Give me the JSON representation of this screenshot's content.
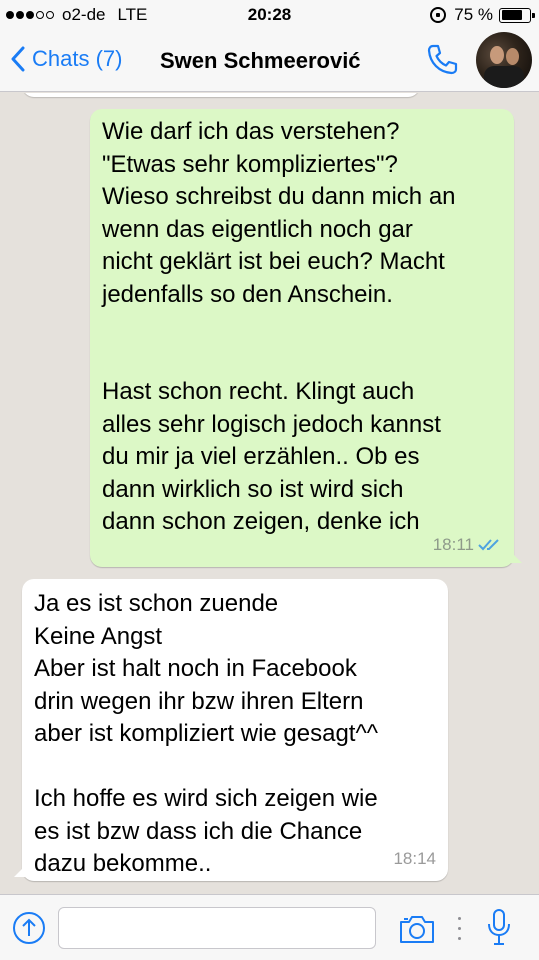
{
  "status_bar": {
    "carrier": "o2-de",
    "network": "LTE",
    "time": "20:28",
    "battery": "75 %",
    "battery_level": 0.75,
    "signal_bars": 3
  },
  "header": {
    "back_label": "Chats (7)",
    "contact_name": "Swen Schmeerović",
    "accent_color": "#1a7cf5"
  },
  "messages": {
    "outgoing": {
      "lines": [
        "Wie darf ich das verstehen?",
        "\"Etwas sehr kompliziertes\"?",
        "Wieso schreibst du dann mich an",
        "wenn das eigentlich noch gar",
        "nicht geklärt ist bei euch? Macht",
        "jedenfalls so den Anschein.",
        "Hast schon recht. Klingt auch",
        "alles sehr logisch jedoch kannst",
        "du mir ja viel erzählen.. Ob es",
        "dann wirklich so ist wird sich",
        "dann schon zeigen, denke ich"
      ],
      "time": "18:11",
      "status": "read",
      "bubble_color": "#dcf8c6"
    },
    "incoming": {
      "lines": [
        "Ja es ist schon zuende",
        "Keine Angst",
        "Aber ist halt noch in Facebook",
        "drin wegen ihr bzw ihren Eltern",
        "aber ist kompliziert wie gesagt^^",
        "Ich hoffe es wird sich zeigen wie",
        "es ist bzw dass ich die Chance",
        "dazu bekomme.."
      ],
      "time": "18:14",
      "bubble_color": "#ffffff"
    }
  },
  "input_bar": {
    "message_value": "",
    "icons": [
      "share-icon",
      "camera-icon",
      "more-icon",
      "microphone-icon"
    ]
  }
}
